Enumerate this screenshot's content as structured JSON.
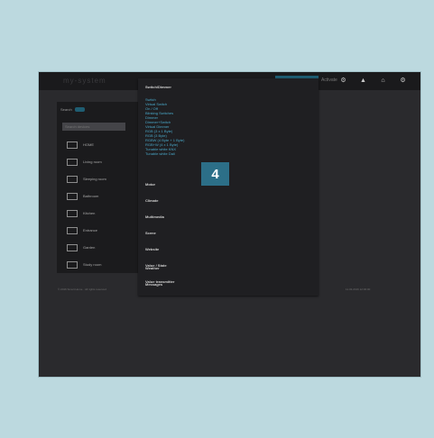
{
  "topbar": {
    "brand": "my-system",
    "activate": "Activate",
    "icons": [
      "gear-icon",
      "bell-icon",
      "home-icon",
      "settings-icon"
    ]
  },
  "sidebar": {
    "search_label": "Search",
    "search_placeholder": "Search devices",
    "items": [
      {
        "label": "HOME",
        "icon": "home-icon"
      },
      {
        "label": "Living room",
        "icon": "sofa-icon"
      },
      {
        "label": "Sleeping room",
        "icon": "bed-icon"
      },
      {
        "label": "Bathroom",
        "icon": "bath-icon"
      },
      {
        "label": "Kitchen",
        "icon": "kitchen-icon"
      },
      {
        "label": "Entrance",
        "icon": "door-icon"
      },
      {
        "label": "Garden",
        "icon": "garden-icon"
      },
      {
        "label": "Study room",
        "icon": "desk-icon"
      }
    ]
  },
  "footer": {
    "left": "© 2016 Smart Home · All rights reserved",
    "right": "11.03.2016 12:00:00"
  },
  "dropdown": {
    "header": "Switch/Dimmer",
    "subitems": [
      "Switch",
      "Virtual Switch",
      "On / Off",
      "Blinking Switches",
      "Dimmer",
      "Dimmer+Switch",
      "Virtual Dimmer",
      "RGB (3 x 1 Byte)",
      "RGB (3 Byte)",
      "RGBW (4 Byte + 1 Byte)",
      "RGB+W (4 x 1 Byte)",
      "Tunable white KNX",
      "Tunable white Dali"
    ],
    "categories": [
      "Motor",
      "Climate",
      "Multimedia",
      "Scene",
      "Website",
      "Value / State",
      "Value transmitter",
      "Weather",
      "Messages"
    ]
  },
  "badge": "4"
}
